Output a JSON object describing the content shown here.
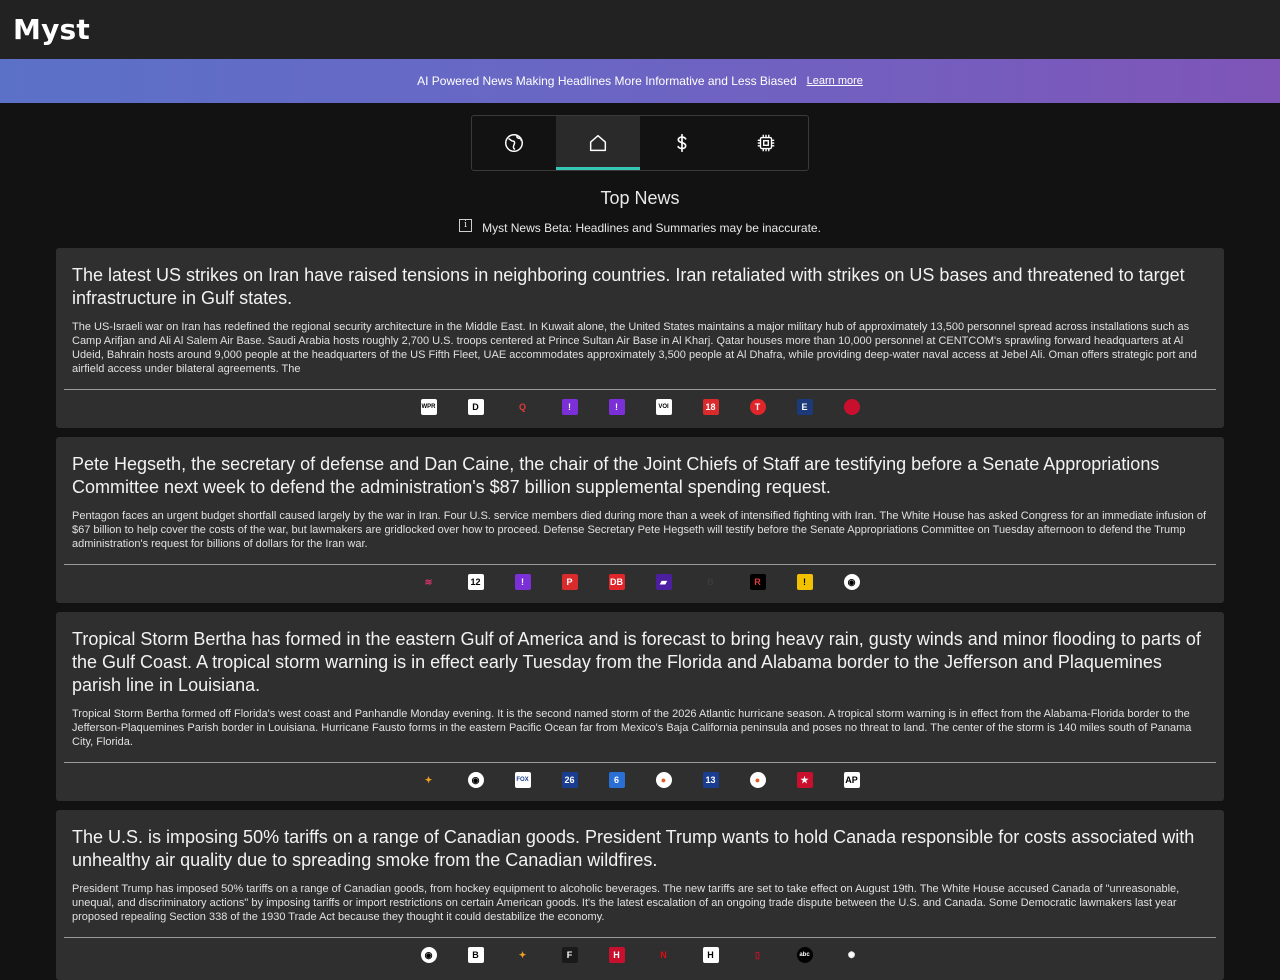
{
  "app": {
    "title": "Myst"
  },
  "banner": {
    "text": "AI Powered News Making Headlines More Informative and Less Biased",
    "link": "Learn more"
  },
  "tabs": [
    {
      "icon": "globe-icon",
      "label": "World"
    },
    {
      "icon": "home-icon",
      "label": "Top"
    },
    {
      "icon": "dollar-icon",
      "label": "Finance"
    },
    {
      "icon": "chip-icon",
      "label": "Technology"
    }
  ],
  "section": {
    "title": "Top News",
    "beta_note": "Myst News Beta: Headlines and Summaries may be inaccurate."
  },
  "articles": [
    {
      "headline": "The latest US strikes on Iran have raised tensions in neighboring countries. Iran retaliated with strikes on US bases and threatened to target infrastructure in Gulf states.",
      "summary": "The US-Israeli war on Iran has redefined the regional security architecture in the Middle East. In Kuwait alone, the United States maintains a major military hub of approximately 13,500 personnel spread across installations such as Camp Arifjan and Ali Al Salem Air Base. Saudi Arabia hosts roughly 2,700 U.S. troops centered at Prince Sultan Air Base in Al Kharj. Qatar houses more than 10,000 personnel at CENTCOM's sprawling forward headquarters at Al Udeid, Bahrain hosts around 9,000 people at the headquarters of the US Fifth Fleet, UAE accommodates approximately 3,500 people at Al Dhafra, while providing deep-water naval access at Jebel Ali. Oman offers strategic port and airfield access under bilateral agreements. The",
      "sources": [
        {
          "text": "WPR",
          "bg": "#ffffff",
          "fg": "#000000"
        },
        {
          "text": "D",
          "bg": "#ffffff",
          "fg": "#000000"
        },
        {
          "text": "Q",
          "bg": "#2f2f2f",
          "fg": "#e03b3b"
        },
        {
          "text": "!",
          "bg": "#7b2fd6",
          "fg": "#ffffff"
        },
        {
          "text": "!",
          "bg": "#7b2fd6",
          "fg": "#ffffff"
        },
        {
          "text": "VOI",
          "bg": "#ffffff",
          "fg": "#000000"
        },
        {
          "text": "18",
          "bg": "#d92b2b",
          "fg": "#ffffff"
        },
        {
          "text": "T",
          "bg": "#e0262b",
          "fg": "#ffffff",
          "round": true
        },
        {
          "text": "E",
          "bg": "#1c3a7a",
          "fg": "#ffffff"
        },
        {
          "text": "",
          "bg": "#c8102e",
          "fg": "#ffffff",
          "round": true
        }
      ]
    },
    {
      "headline": "Pete Hegseth, the secretary of defense and Dan Caine, the chair of the Joint Chiefs of Staff are testifying before a Senate Appropriations Committee next week to defend the administration's $87 billion supplemental spending request.",
      "summary": "Pentagon faces an urgent budget shortfall caused largely by the war in Iran. Four U.S. service members died during more than a week of intensified fighting with Iran. The White House has asked Congress for an immediate infusion of $67 billion to help cover the costs of the war, but lawmakers are gridlocked over how to proceed. Defense Secretary Pete Hegseth will testify before the Senate Appropriations Committee on Tuesday afternoon to defend the Trump administration's request for billions of dollars for the Iran war.",
      "sources": [
        {
          "text": "≋",
          "bg": "#2f2f2f",
          "fg": "#d6336c"
        },
        {
          "text": "12",
          "bg": "#ffffff",
          "fg": "#000000"
        },
        {
          "text": "!",
          "bg": "#7b2fd6",
          "fg": "#ffffff"
        },
        {
          "text": "P",
          "bg": "#d92b2b",
          "fg": "#ffffff"
        },
        {
          "text": "DB",
          "bg": "#e0262b",
          "fg": "#ffffff"
        },
        {
          "text": "▰",
          "bg": "#4b1fa0",
          "fg": "#ffffff"
        },
        {
          "text": "B",
          "bg": "#2f2f2f",
          "fg": "#3a3a3a"
        },
        {
          "text": "R",
          "bg": "#000000",
          "fg": "#e03b3b"
        },
        {
          "text": "!",
          "bg": "#f2c200",
          "fg": "#000000"
        },
        {
          "text": "◉",
          "bg": "#ffffff",
          "fg": "#000000",
          "round": true
        }
      ]
    },
    {
      "headline": "Tropical Storm Bertha has formed in the eastern Gulf of America and is forecast to bring heavy rain, gusty winds and minor flooding to parts of the Gulf Coast. A tropical storm warning is in effect early Tuesday from the Florida and Alabama border to the Jefferson and Plaquemines parish line in Louisiana.",
      "summary": "Tropical Storm Bertha formed off Florida's west coast and Panhandle Monday evening. It is the second named storm of the 2026 Atlantic hurricane season. A tropical storm warning is in effect from the Alabama-Florida border to the Jefferson-Plaquemines Parish border in Louisiana. Hurricane Fausto forms in the eastern Pacific Ocean far from Mexico's Baja California peninsula and poses no threat to land. The center of the storm is 140 miles south of Panama City, Florida.",
      "sources": [
        {
          "text": "✦",
          "bg": "#2f2f2f",
          "fg": "#f0a020"
        },
        {
          "text": "◉",
          "bg": "#ffffff",
          "fg": "#000000",
          "round": true
        },
        {
          "text": "FOX",
          "bg": "#ffffff",
          "fg": "#1a3d8f"
        },
        {
          "text": "26",
          "bg": "#1a3d8f",
          "fg": "#ffffff"
        },
        {
          "text": "6",
          "bg": "#2a6fd6",
          "fg": "#ffffff"
        },
        {
          "text": "●",
          "bg": "#ffffff",
          "fg": "#e05a20",
          "round": true
        },
        {
          "text": "13",
          "bg": "#1a3d8f",
          "fg": "#ffffff"
        },
        {
          "text": "●",
          "bg": "#ffffff",
          "fg": "#e05a20",
          "round": true
        },
        {
          "text": "★",
          "bg": "#c8102e",
          "fg": "#ffffff"
        },
        {
          "text": "AP",
          "bg": "#ffffff",
          "fg": "#000000"
        }
      ]
    },
    {
      "headline": "The U.S. is imposing 50% tariffs on a range of Canadian goods. President Trump wants to hold Canada responsible for costs associated with unhealthy air quality due to spreading smoke from the Canadian wildfires.",
      "summary": "President Trump has imposed 50% tariffs on a range of Canadian goods, from hockey equipment to alcoholic beverages. The new tariffs are set to take effect on August 19th. The White House accused Canada of \"unreasonable, unequal, and discriminatory actions\" by imposing tariffs or import restrictions on certain American goods. It's the latest escalation of an ongoing trade dispute between the U.S. and Canada. Some Democratic lawmakers last year proposed repealing Section 338 of the 1930 Trade Act because they thought it could destabilize the economy.",
      "sources": [
        {
          "text": "◉",
          "bg": "#ffffff",
          "fg": "#000000",
          "round": true
        },
        {
          "text": "B",
          "bg": "#ffffff",
          "fg": "#000000"
        },
        {
          "text": "✦",
          "bg": "#2f2f2f",
          "fg": "#f0a020"
        },
        {
          "text": "F",
          "bg": "#1a1a1a",
          "fg": "#ffffff"
        },
        {
          "text": "H",
          "bg": "#c8102e",
          "fg": "#ffffff"
        },
        {
          "text": "N",
          "bg": "#2f2f2f",
          "fg": "#e50914"
        },
        {
          "text": "H",
          "bg": "#ffffff",
          "fg": "#000000"
        },
        {
          "text": "▯",
          "bg": "#2f2f2f",
          "fg": "#c8102e"
        },
        {
          "text": "abc",
          "bg": "#000000",
          "fg": "#ffffff",
          "round": true
        },
        {
          "text": "✺",
          "bg": "#2f2f2f",
          "fg": "#ffffff"
        }
      ]
    }
  ]
}
